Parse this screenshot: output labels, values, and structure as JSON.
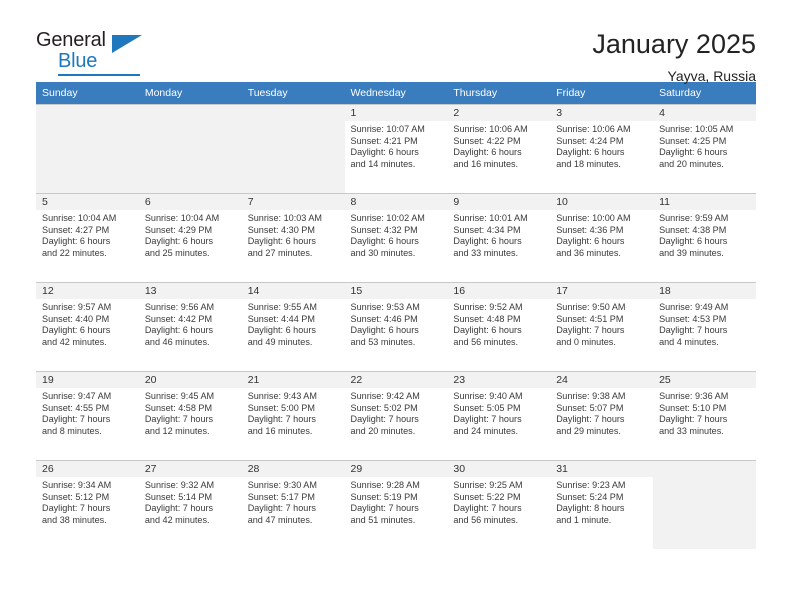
{
  "logo": {
    "line1": "General",
    "line2": "Blue",
    "triangle_color": "#1f77bd"
  },
  "header": {
    "title": "January 2025",
    "location": "Yayva, Russia"
  },
  "theme": {
    "header_bg": "#3a7dbf",
    "daynum_bg": "#f2f2f2",
    "grid_line": "#c8c8c8"
  },
  "weekdays": [
    "Sunday",
    "Monday",
    "Tuesday",
    "Wednesday",
    "Thursday",
    "Friday",
    "Saturday"
  ],
  "labels": {
    "sunrise": "Sunrise:",
    "sunset": "Sunset:",
    "daylight": "Daylight:"
  },
  "weeks": [
    [
      {
        "day": "",
        "sunrise": "",
        "sunset": "",
        "daylight1": "",
        "daylight2": "",
        "empty": true
      },
      {
        "day": "",
        "sunrise": "",
        "sunset": "",
        "daylight1": "",
        "daylight2": "",
        "empty": true
      },
      {
        "day": "",
        "sunrise": "",
        "sunset": "",
        "daylight1": "",
        "daylight2": "",
        "empty": true
      },
      {
        "day": "1",
        "sunrise": "Sunrise: 10:07 AM",
        "sunset": "Sunset: 4:21 PM",
        "daylight1": "Daylight: 6 hours",
        "daylight2": "and 14 minutes.",
        "empty": false
      },
      {
        "day": "2",
        "sunrise": "Sunrise: 10:06 AM",
        "sunset": "Sunset: 4:22 PM",
        "daylight1": "Daylight: 6 hours",
        "daylight2": "and 16 minutes.",
        "empty": false
      },
      {
        "day": "3",
        "sunrise": "Sunrise: 10:06 AM",
        "sunset": "Sunset: 4:24 PM",
        "daylight1": "Daylight: 6 hours",
        "daylight2": "and 18 minutes.",
        "empty": false
      },
      {
        "day": "4",
        "sunrise": "Sunrise: 10:05 AM",
        "sunset": "Sunset: 4:25 PM",
        "daylight1": "Daylight: 6 hours",
        "daylight2": "and 20 minutes.",
        "empty": false
      }
    ],
    [
      {
        "day": "5",
        "sunrise": "Sunrise: 10:04 AM",
        "sunset": "Sunset: 4:27 PM",
        "daylight1": "Daylight: 6 hours",
        "daylight2": "and 22 minutes.",
        "empty": false
      },
      {
        "day": "6",
        "sunrise": "Sunrise: 10:04 AM",
        "sunset": "Sunset: 4:29 PM",
        "daylight1": "Daylight: 6 hours",
        "daylight2": "and 25 minutes.",
        "empty": false
      },
      {
        "day": "7",
        "sunrise": "Sunrise: 10:03 AM",
        "sunset": "Sunset: 4:30 PM",
        "daylight1": "Daylight: 6 hours",
        "daylight2": "and 27 minutes.",
        "empty": false
      },
      {
        "day": "8",
        "sunrise": "Sunrise: 10:02 AM",
        "sunset": "Sunset: 4:32 PM",
        "daylight1": "Daylight: 6 hours",
        "daylight2": "and 30 minutes.",
        "empty": false
      },
      {
        "day": "9",
        "sunrise": "Sunrise: 10:01 AM",
        "sunset": "Sunset: 4:34 PM",
        "daylight1": "Daylight: 6 hours",
        "daylight2": "and 33 minutes.",
        "empty": false
      },
      {
        "day": "10",
        "sunrise": "Sunrise: 10:00 AM",
        "sunset": "Sunset: 4:36 PM",
        "daylight1": "Daylight: 6 hours",
        "daylight2": "and 36 minutes.",
        "empty": false
      },
      {
        "day": "11",
        "sunrise": "Sunrise: 9:59 AM",
        "sunset": "Sunset: 4:38 PM",
        "daylight1": "Daylight: 6 hours",
        "daylight2": "and 39 minutes.",
        "empty": false
      }
    ],
    [
      {
        "day": "12",
        "sunrise": "Sunrise: 9:57 AM",
        "sunset": "Sunset: 4:40 PM",
        "daylight1": "Daylight: 6 hours",
        "daylight2": "and 42 minutes.",
        "empty": false
      },
      {
        "day": "13",
        "sunrise": "Sunrise: 9:56 AM",
        "sunset": "Sunset: 4:42 PM",
        "daylight1": "Daylight: 6 hours",
        "daylight2": "and 46 minutes.",
        "empty": false
      },
      {
        "day": "14",
        "sunrise": "Sunrise: 9:55 AM",
        "sunset": "Sunset: 4:44 PM",
        "daylight1": "Daylight: 6 hours",
        "daylight2": "and 49 minutes.",
        "empty": false
      },
      {
        "day": "15",
        "sunrise": "Sunrise: 9:53 AM",
        "sunset": "Sunset: 4:46 PM",
        "daylight1": "Daylight: 6 hours",
        "daylight2": "and 53 minutes.",
        "empty": false
      },
      {
        "day": "16",
        "sunrise": "Sunrise: 9:52 AM",
        "sunset": "Sunset: 4:48 PM",
        "daylight1": "Daylight: 6 hours",
        "daylight2": "and 56 minutes.",
        "empty": false
      },
      {
        "day": "17",
        "sunrise": "Sunrise: 9:50 AM",
        "sunset": "Sunset: 4:51 PM",
        "daylight1": "Daylight: 7 hours",
        "daylight2": "and 0 minutes.",
        "empty": false
      },
      {
        "day": "18",
        "sunrise": "Sunrise: 9:49 AM",
        "sunset": "Sunset: 4:53 PM",
        "daylight1": "Daylight: 7 hours",
        "daylight2": "and 4 minutes.",
        "empty": false
      }
    ],
    [
      {
        "day": "19",
        "sunrise": "Sunrise: 9:47 AM",
        "sunset": "Sunset: 4:55 PM",
        "daylight1": "Daylight: 7 hours",
        "daylight2": "and 8 minutes.",
        "empty": false
      },
      {
        "day": "20",
        "sunrise": "Sunrise: 9:45 AM",
        "sunset": "Sunset: 4:58 PM",
        "daylight1": "Daylight: 7 hours",
        "daylight2": "and 12 minutes.",
        "empty": false
      },
      {
        "day": "21",
        "sunrise": "Sunrise: 9:43 AM",
        "sunset": "Sunset: 5:00 PM",
        "daylight1": "Daylight: 7 hours",
        "daylight2": "and 16 minutes.",
        "empty": false
      },
      {
        "day": "22",
        "sunrise": "Sunrise: 9:42 AM",
        "sunset": "Sunset: 5:02 PM",
        "daylight1": "Daylight: 7 hours",
        "daylight2": "and 20 minutes.",
        "empty": false
      },
      {
        "day": "23",
        "sunrise": "Sunrise: 9:40 AM",
        "sunset": "Sunset: 5:05 PM",
        "daylight1": "Daylight: 7 hours",
        "daylight2": "and 24 minutes.",
        "empty": false
      },
      {
        "day": "24",
        "sunrise": "Sunrise: 9:38 AM",
        "sunset": "Sunset: 5:07 PM",
        "daylight1": "Daylight: 7 hours",
        "daylight2": "and 29 minutes.",
        "empty": false
      },
      {
        "day": "25",
        "sunrise": "Sunrise: 9:36 AM",
        "sunset": "Sunset: 5:10 PM",
        "daylight1": "Daylight: 7 hours",
        "daylight2": "and 33 minutes.",
        "empty": false
      }
    ],
    [
      {
        "day": "26",
        "sunrise": "Sunrise: 9:34 AM",
        "sunset": "Sunset: 5:12 PM",
        "daylight1": "Daylight: 7 hours",
        "daylight2": "and 38 minutes.",
        "empty": false
      },
      {
        "day": "27",
        "sunrise": "Sunrise: 9:32 AM",
        "sunset": "Sunset: 5:14 PM",
        "daylight1": "Daylight: 7 hours",
        "daylight2": "and 42 minutes.",
        "empty": false
      },
      {
        "day": "28",
        "sunrise": "Sunrise: 9:30 AM",
        "sunset": "Sunset: 5:17 PM",
        "daylight1": "Daylight: 7 hours",
        "daylight2": "and 47 minutes.",
        "empty": false
      },
      {
        "day": "29",
        "sunrise": "Sunrise: 9:28 AM",
        "sunset": "Sunset: 5:19 PM",
        "daylight1": "Daylight: 7 hours",
        "daylight2": "and 51 minutes.",
        "empty": false
      },
      {
        "day": "30",
        "sunrise": "Sunrise: 9:25 AM",
        "sunset": "Sunset: 5:22 PM",
        "daylight1": "Daylight: 7 hours",
        "daylight2": "and 56 minutes.",
        "empty": false
      },
      {
        "day": "31",
        "sunrise": "Sunrise: 9:23 AM",
        "sunset": "Sunset: 5:24 PM",
        "daylight1": "Daylight: 8 hours",
        "daylight2": "and 1 minute.",
        "empty": false
      },
      {
        "day": "",
        "sunrise": "",
        "sunset": "",
        "daylight1": "",
        "daylight2": "",
        "empty": true
      }
    ]
  ]
}
